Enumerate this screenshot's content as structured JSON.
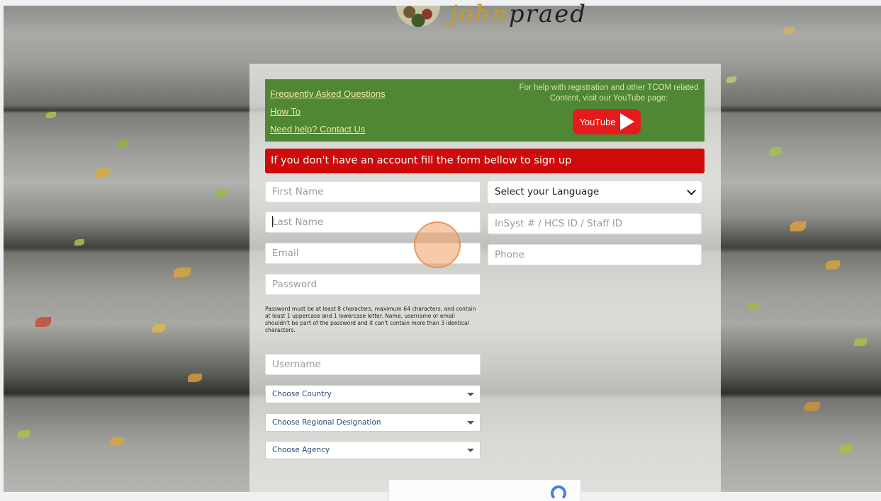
{
  "help_box": {
    "links": [
      "Frequently Asked Questions",
      "How To",
      "Need help? Contact Us"
    ],
    "youtube_text": "For help with registration and other TCOM related Content, visit our YouTube page:",
    "youtube_button": "YouTube"
  },
  "signup_banner": "If you don't have an account fill the form bellow to sign up",
  "form": {
    "first_name_placeholder": "First Name",
    "last_name_placeholder": "Last Name",
    "email_placeholder": "Email",
    "password_placeholder": "Password",
    "password_help": "Password must be at least 8 characters, maximum 64 characters, and contain at least 1 uppercase and 1 lowercase letter. Name, username or email shouldn't be part of the password and it can't contain more than 3 identical characters.",
    "username_placeholder": "Username",
    "language_select": "Select your Language",
    "id_placeholder": "InSyst # / HCS ID / Staff ID",
    "phone_placeholder": "Phone",
    "country_select": "Choose Country",
    "regional_select": "Choose Regional Designation",
    "agency_select": "Choose Agency"
  },
  "colors": {
    "help_green": "#4f8734",
    "banner_red": "#cf0a0a",
    "youtube_red": "#e51b1b",
    "link_yellow": "#f3e7a5"
  },
  "icons": [
    "youtube-play-icon",
    "chevron-down-icon",
    "caret-down-icon",
    "recaptcha-icon",
    "logo-tree-icon"
  ]
}
